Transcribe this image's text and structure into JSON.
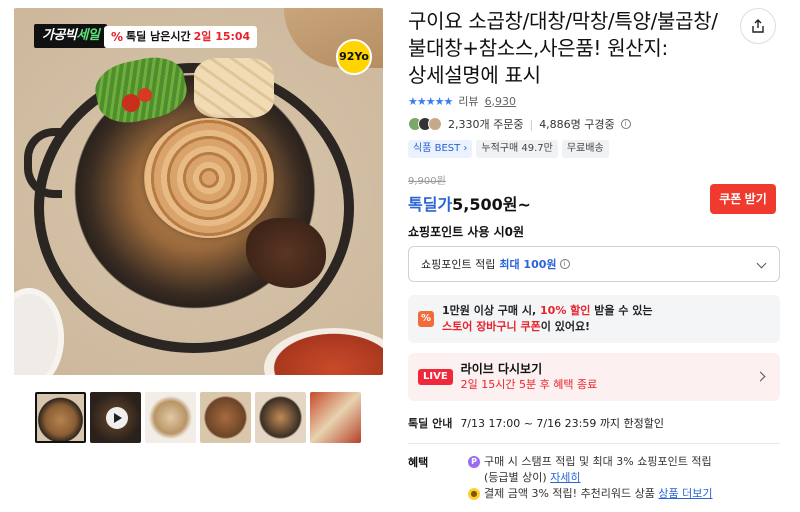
{
  "gallery": {
    "sale_badge_a": "가공빅",
    "sale_badge_b": "세일",
    "timer_label": "톡딜 남은시간",
    "timer_value": "2일 15:04",
    "brand_logo": "92Yo",
    "thumbnails": [
      "thumb-1",
      "thumb-video",
      "thumb-3",
      "thumb-4",
      "thumb-5",
      "thumb-6"
    ]
  },
  "product": {
    "title": "구이요 소곱창/대창/막창/특양/불곱창/불대창+참소스,사은품! 원산지: 상세설명에 표시",
    "rating_stars": "★★★★★",
    "review_label": "리뷰",
    "review_count": "6,930",
    "orders": "2,330개 주문중",
    "subscribers": "4,886명 구경중",
    "chips": [
      "식품 BEST",
      "누적구매 49.7만",
      "무료배송"
    ],
    "original_price": "9,900원",
    "price_label": "톡딜가",
    "price_value": "5,500원~",
    "coupon_button": "쿠폰 받기",
    "point_use": "쇼핑포인트 사용 시0원",
    "point_dd_label": "쇼핑포인트 적립",
    "point_dd_value": "최대 100원",
    "cart_coupon_line1_a": "1만원 이상 구매 시,",
    "cart_coupon_line1_b": "10% 할인",
    "cart_coupon_line1_c": "받을 수 있는",
    "cart_coupon_line2_a": "스토어 장바구니 쿠폰",
    "cart_coupon_line2_b": "이 있어요!",
    "live_badge": "LIVE",
    "live_title": "라이브 다시보기",
    "live_sub": "2일 15시간 5분 후 혜택 종료",
    "deal_label": "톡딜 안내",
    "deal_value": "7/13 17:00 ~ 7/16 23:59 까지 한정할인",
    "benefit_label": "혜택",
    "benefit_line1": "구매 시 스탬프 적립 및 최대 3% 쇼핑포인트 적립",
    "benefit_line1b": "(등급별 상이)",
    "benefit_link1": "자세히",
    "benefit_line2": "결제 금액 3% 적립! 추천리워드 상품",
    "benefit_link2": "상품 더보기"
  },
  "colors": {
    "accent_blue": "#2a64d6",
    "accent_red": "#f03a2e",
    "live_bg": "#fdf0f1"
  }
}
